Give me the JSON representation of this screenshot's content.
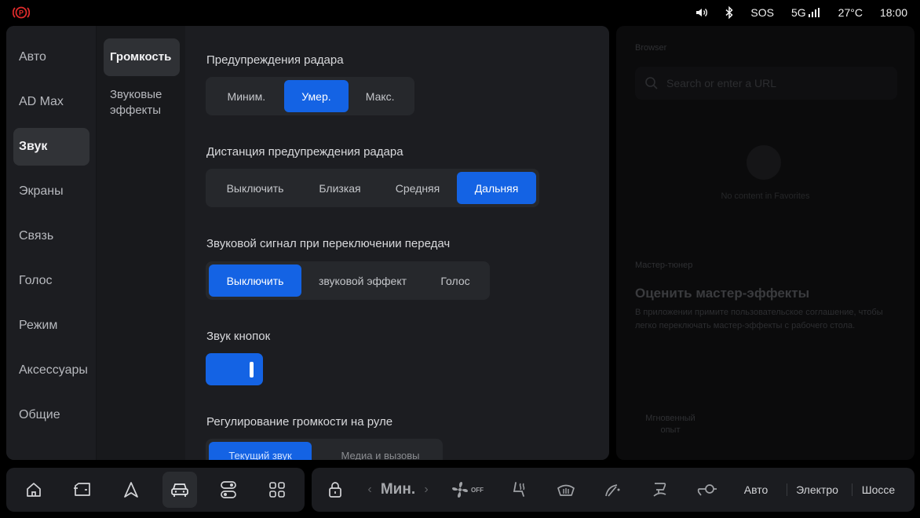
{
  "status": {
    "sos": "SOS",
    "network": "5G",
    "temperature": "27°C",
    "time": "18:00"
  },
  "nav_primary": [
    {
      "label": "Авто",
      "active": false
    },
    {
      "label": "AD Max",
      "active": false
    },
    {
      "label": "Звук",
      "active": true
    },
    {
      "label": "Экраны",
      "active": false
    },
    {
      "label": "Связь",
      "active": false
    },
    {
      "label": "Голос",
      "active": false
    },
    {
      "label": "Режим",
      "active": false
    },
    {
      "label": "Аксессуары",
      "active": false
    },
    {
      "label": "Общие",
      "active": false
    }
  ],
  "nav_secondary": [
    {
      "label": "Громкость",
      "active": true
    },
    {
      "label": "Звуковые эффекты",
      "active": false
    }
  ],
  "sections": {
    "radar_warning": {
      "title": "Предупреждения радара",
      "options": [
        "Миним.",
        "Умер.",
        "Макс."
      ],
      "selected": "Умер."
    },
    "radar_distance": {
      "title": "Дистанция предупреждения радара",
      "options": [
        "Выключить",
        "Близкая",
        "Средняя",
        "Дальняя"
      ],
      "selected": "Дальняя"
    },
    "gear_sound": {
      "title": "Звуковой сигнал при переключении передач",
      "options": [
        "Выключить",
        "звуковой эффект",
        "Голос"
      ],
      "selected": "Выключить"
    },
    "button_sound": {
      "title": "Звук кнопок",
      "enabled": true
    },
    "wheel_volume": {
      "title": "Регулирование громкости на руле",
      "options": [
        "Текущий звук",
        "Медиа и вызовы"
      ]
    }
  },
  "right_panel": {
    "browser_label": "Browser",
    "search_placeholder": "Search or enter a URL",
    "empty_text": "No content in Favorites",
    "tuner_label": "Мастер-тюнер",
    "tuner_title": "Оценить мастер-эффекты",
    "tuner_desc": "В приложении примите пользовательское соглашение, чтобы легко переключать мастер-эффекты с рабочего стола.",
    "instant_label": "Мгновенный опыт"
  },
  "dock": {
    "apps": [
      "home-icon",
      "car-door-icon",
      "navigation-icon",
      "car-icon",
      "toggles-icon",
      "apps-grid-icon"
    ],
    "active_app": "car-icon",
    "fan_speed": "Мин.",
    "fan_state": "OFF",
    "modes": [
      "Авто",
      "Электро",
      "Шоссе"
    ]
  },
  "colors": {
    "accent": "#1463e4",
    "panel": "#1c1d21",
    "background": "#000000",
    "brake_warning": "#e02b2b"
  }
}
